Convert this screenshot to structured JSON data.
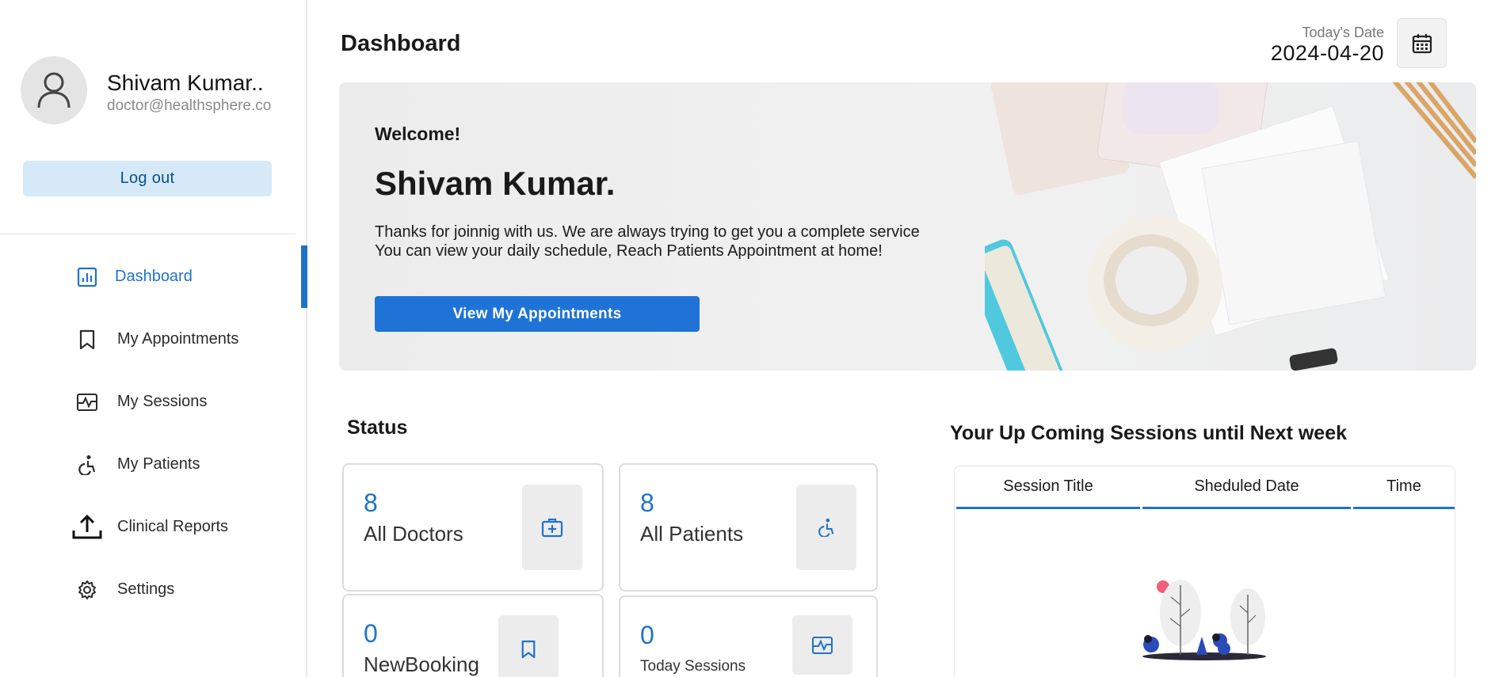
{
  "profile": {
    "name": "Shivam Kumar..",
    "email": "doctor@healthsphere.co",
    "logout_label": "Log out"
  },
  "nav": {
    "dashboard": "Dashboard",
    "appointments": "My Appointments",
    "sessions": "My Sessions",
    "patients": "My Patients",
    "reports": "Clinical Reports",
    "settings": "Settings"
  },
  "header": {
    "title": "Dashboard",
    "date_label": "Today's Date",
    "date_value": "2024-04-20"
  },
  "banner": {
    "welcome": "Welcome!",
    "name": "Shivam Kumar.",
    "line1": "Thanks for joinnig with us. We are always trying to get you a complete service",
    "line2": "You can view your daily schedule, Reach Patients Appointment at home!",
    "button": "View My Appointments"
  },
  "status": {
    "title": "Status",
    "cards": [
      {
        "value": "8",
        "label": "All Doctors",
        "icon": "medical-kit-icon"
      },
      {
        "value": "8",
        "label": "All Patients",
        "icon": "wheelchair-icon"
      },
      {
        "value": "0",
        "label": "NewBooking",
        "icon": "bookmark-icon"
      },
      {
        "value": "0",
        "label": "Today Sessions",
        "icon": "activity-icon"
      }
    ]
  },
  "sessions": {
    "title": "Your Up Coming Sessions until Next week",
    "columns": [
      "Session Title",
      "Sheduled Date",
      "Time"
    ]
  },
  "colors": {
    "accent": "#1f73c7",
    "button": "#1f73d6",
    "logout_bg": "#d6e9f8"
  }
}
